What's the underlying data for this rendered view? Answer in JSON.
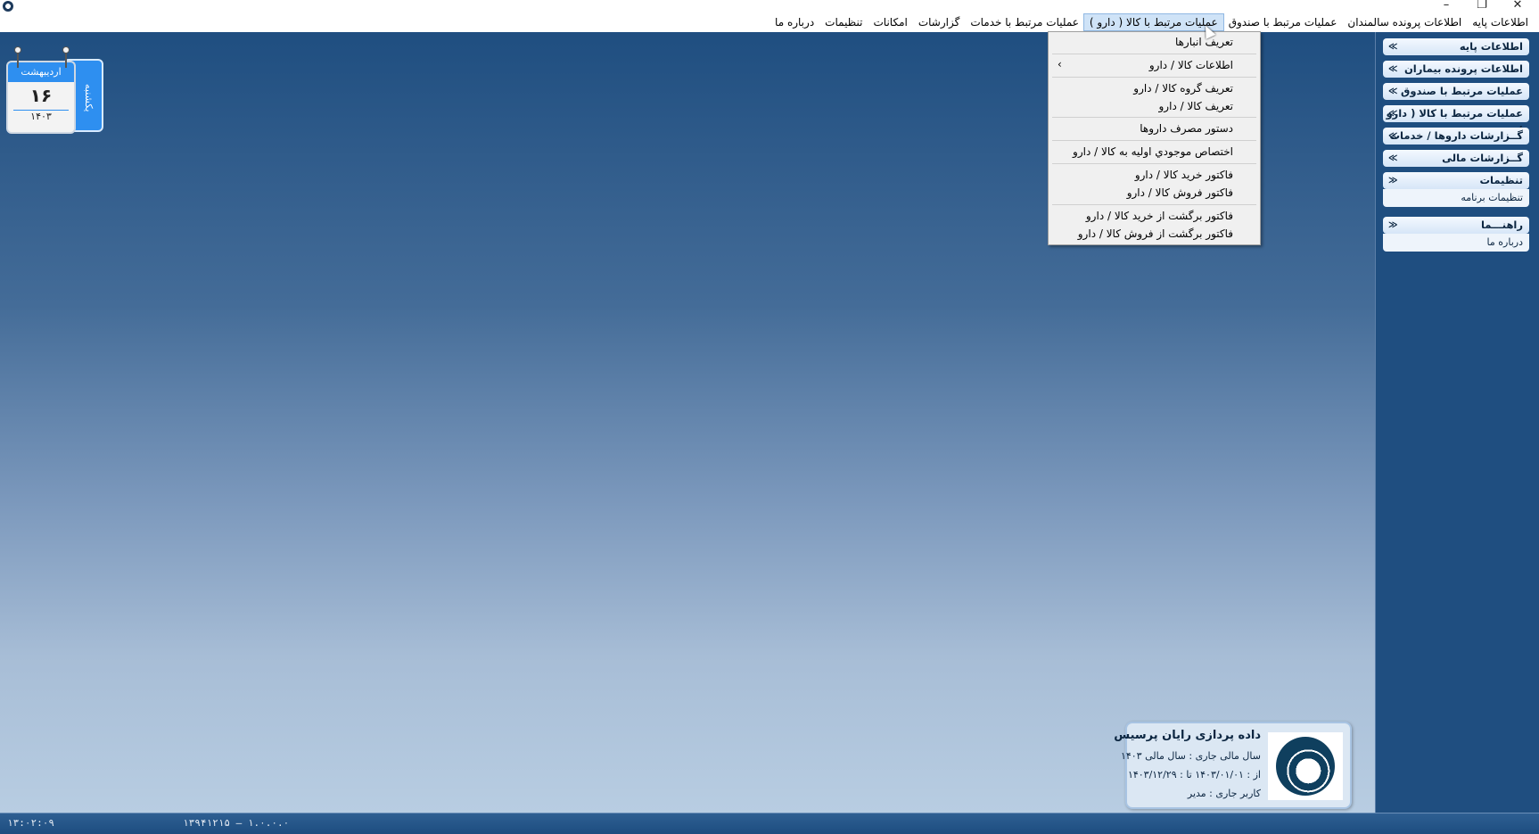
{
  "window": {
    "minimize": "–",
    "restore": "❐",
    "close": "✕"
  },
  "menubar": {
    "items": [
      "اطلاعات پایه",
      "اطلاعات پرونده سالمندان",
      "عملیات مرتبط با صندوق",
      "عملیات مرتبط با کالا ( دارو )",
      "عملیات مرتبط با خدمات",
      "گزارشات",
      "امکانات",
      "تنظیمات",
      "درباره ما"
    ],
    "active_index": 3
  },
  "dropdown": {
    "items": [
      "تعریف انبارها",
      "اطلاعات کالا / دارو",
      "تعریف گروه کالا / دارو",
      "تعریف کالا / دارو",
      "دستور مصرف داروها",
      "اختصاص موجودي اولیه به کالا / دارو",
      "فاکتور خرید کالا / دارو",
      "فاکتور فروش کالا / دارو",
      "فاکتور برگشت از خرید کالا / دارو",
      "فاکتور برگشت از فروش کالا / دارو"
    ],
    "submenu_arrow": "›"
  },
  "sidepanel": {
    "groups": [
      {
        "title": "اطلاعات پایه",
        "chevron": "≫"
      },
      {
        "title": "اطلاعات پرونده بیماران",
        "chevron": "≫"
      },
      {
        "title": "عملیات مرتبط با صندوق",
        "chevron": "≫"
      },
      {
        "title": "عملیات مرتبط با کالا ( دارو )",
        "chevron": "≫"
      },
      {
        "title": "گــزارشات داروها / خدمات",
        "chevron": "≫"
      },
      {
        "title": "گــزارشات مالی",
        "chevron": "≫"
      },
      {
        "title": "تنظیمات",
        "chevron": "≪",
        "items": [
          "تنظیمات برنامه"
        ]
      },
      {
        "title": "راهنـــما",
        "chevron": "≪",
        "items": [
          "درباره ما"
        ]
      }
    ]
  },
  "calendar": {
    "month": "اردیبهشت",
    "day": "۱۶",
    "year": "۱۴۰۳",
    "weekday": "یکشنبه"
  },
  "company": {
    "name": "داده پردازی رایان پرسیس",
    "fiscal_year": "سال مالی جاری  :  سال مالی ۱۴۰۳",
    "date_range": "از : ۱۴۰۳/۰۱/۰۱   تا : ۱۴۰۳/۱۲/۲۹",
    "user": "کاربر جاری :          مدیر"
  },
  "status": {
    "time": "۱۳:۰۲:۰۹",
    "version": "۱۳۹۴۱۲۱۵ – ۱.۰.۰.۰"
  },
  "colors": {
    "desktop_top": "#1f4e80",
    "desktop_bottom": "#b8cde2",
    "calendar_accent": "#2e8ff0",
    "logo": "#0f3f5e"
  }
}
